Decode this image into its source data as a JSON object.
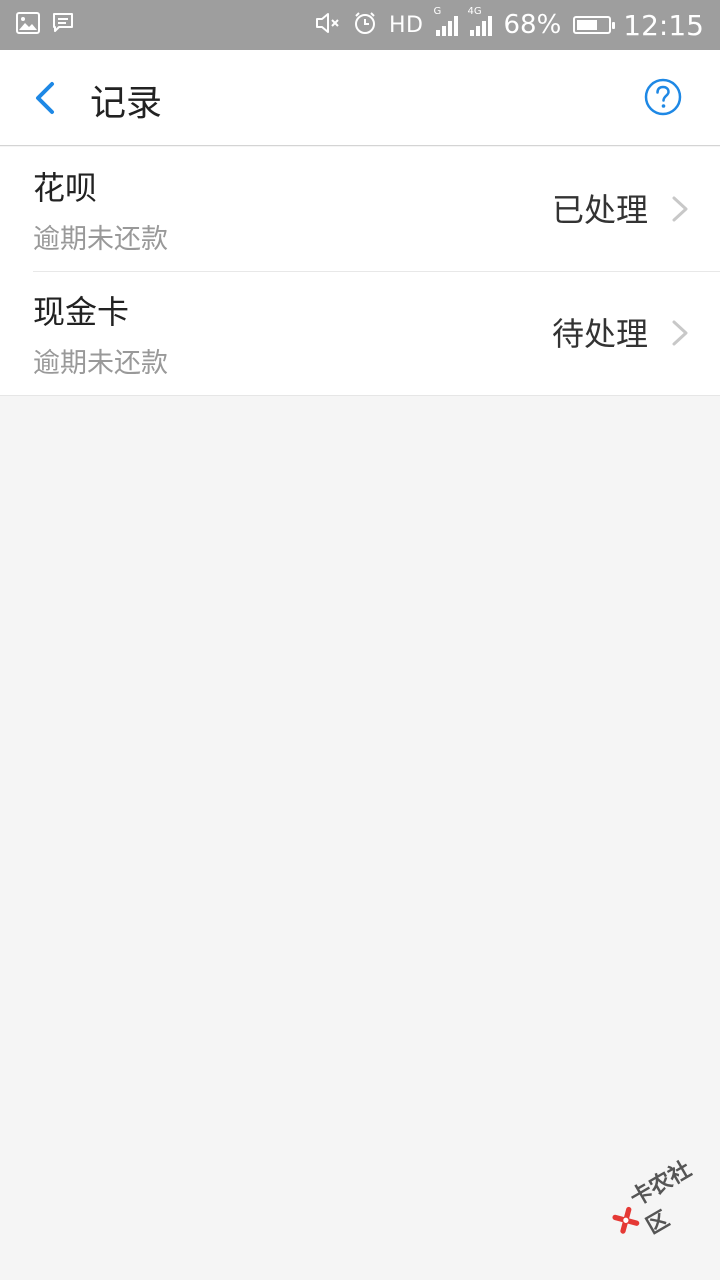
{
  "statusbar": {
    "network_label": "HD",
    "sim1_label": "G",
    "sim2_label": "4G",
    "battery_percent": "68%",
    "battery_level": 0.68,
    "time": "12:15"
  },
  "header": {
    "title": "记录"
  },
  "records": [
    {
      "title": "花呗",
      "subtitle": "逾期未还款",
      "status": "已处理"
    },
    {
      "title": "现金卡",
      "subtitle": "逾期未还款",
      "status": "待处理"
    }
  ],
  "watermark": {
    "text": "卡农社区"
  },
  "colors": {
    "accent": "#1e88e5",
    "statusbar_bg": "#9e9e9e",
    "page_bg": "#f5f5f5"
  }
}
